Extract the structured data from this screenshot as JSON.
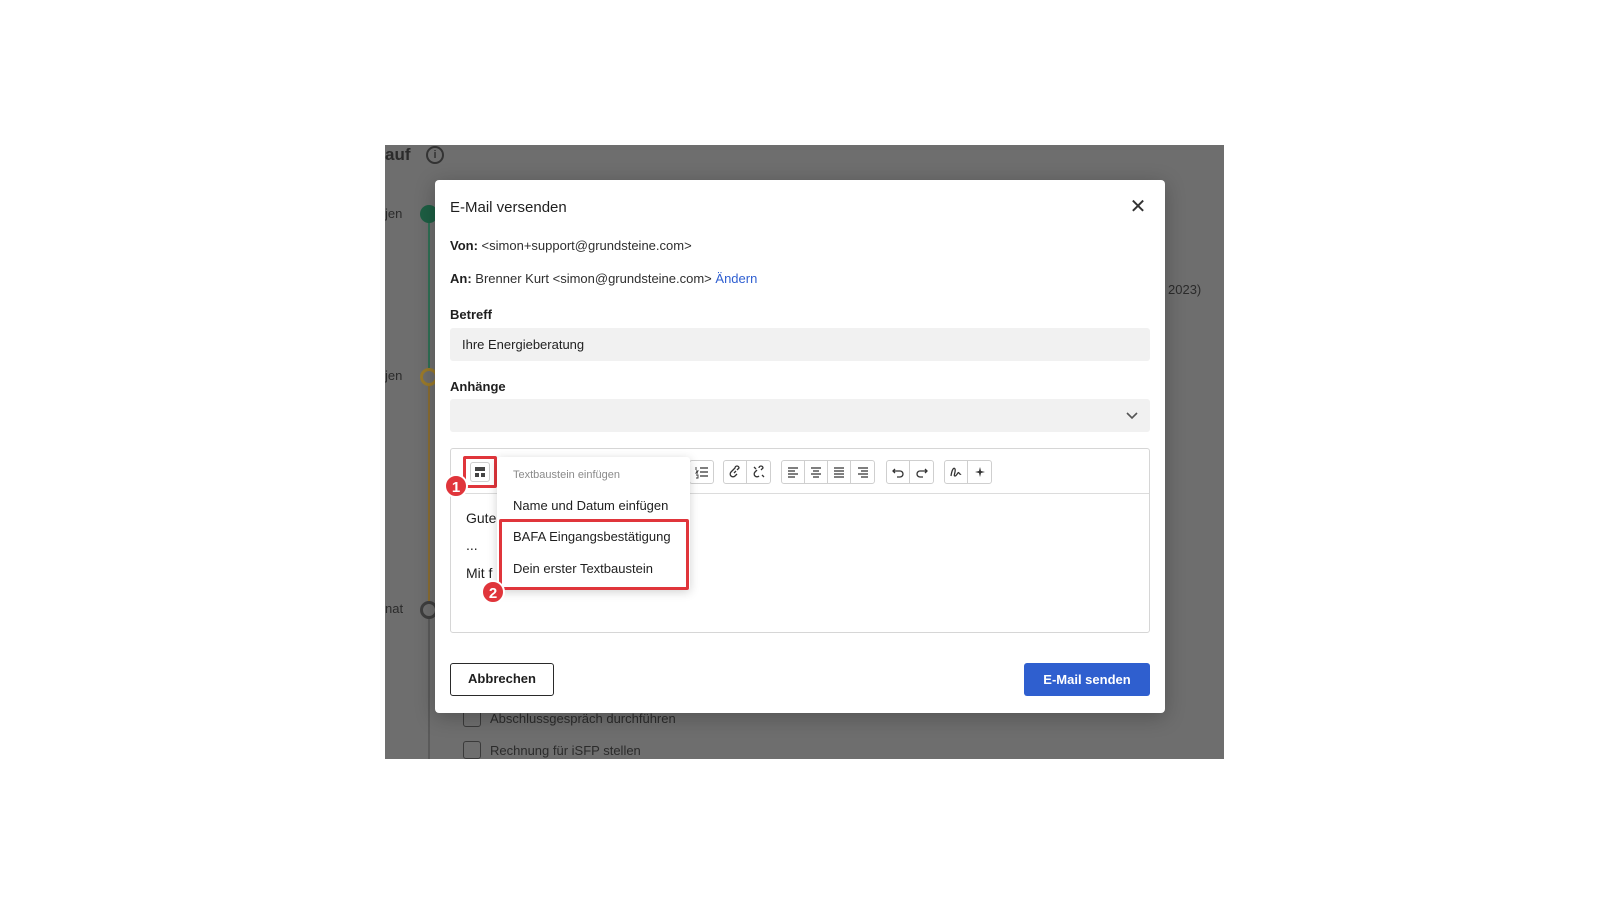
{
  "background": {
    "title": "auf",
    "steps": [
      "jen",
      "jen",
      "nat"
    ],
    "side_text": "2023)",
    "tasks": [
      "Abschlussgespräch durchführen",
      "Rechnung für iSFP stellen"
    ]
  },
  "modal": {
    "title": "E-Mail versenden",
    "from_label": "Von:",
    "from_value": "<simon+support@grundsteine.com>",
    "to_label": "An:",
    "to_value": "Brenner Kurt <simon@grundsteine.com>",
    "to_change_link": "Ändern",
    "subject_label": "Betreff",
    "subject_value": "Ihre Energieberatung",
    "attachments_label": "Anhänge",
    "attachments_value": "",
    "body_lines": [
      "Gute",
      "...",
      "Mit f"
    ],
    "cancel_label": "Abbrechen",
    "send_label": "E-Mail senden"
  },
  "snippet_menu": {
    "header": "Textbaustein einfügen",
    "items": [
      "Name und Datum einfügen",
      "BAFA Eingangsbestätigung",
      "Dein erster Textbaustein"
    ]
  },
  "annotations": {
    "step1": "1",
    "step2": "2"
  },
  "colors": {
    "accent": "#2f5fcf",
    "highlight": "#e0353b",
    "overlay": "#6e6e6e"
  }
}
